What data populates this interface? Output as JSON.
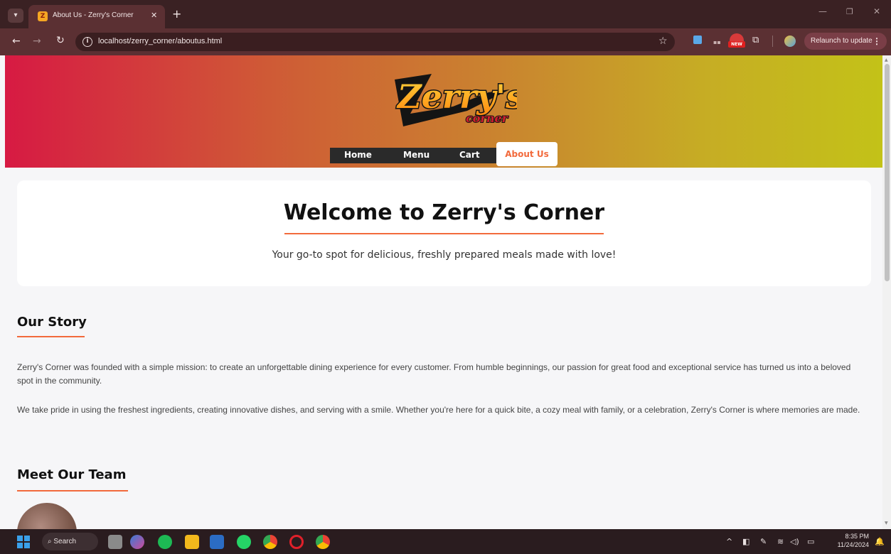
{
  "browser": {
    "tab_title": "About Us - Zerry's Corner",
    "url": "localhost/zerry_corner/aboutus.html",
    "relaunch_label": "Relaunch to update",
    "new_badge": "NEW"
  },
  "nav": {
    "items": [
      {
        "label": "Home"
      },
      {
        "label": "Menu"
      },
      {
        "label": "Cart"
      },
      {
        "label": "About Us",
        "active": true
      }
    ]
  },
  "logo": {
    "main": "Zerry's",
    "sub": "corner"
  },
  "welcome": {
    "title": "Welcome to Zerry's Corner",
    "subtitle": "Your go-to spot for delicious, freshly prepared meals made with love!"
  },
  "story": {
    "title": "Our Story",
    "paragraphs": [
      "Zerry's Corner was founded with a simple mission: to create an unforgettable dining experience for every customer. From humble beginnings, our passion for great food and exceptional service has turned us into a beloved spot in the community.",
      "We take pride in using the freshest ingredients, creating innovative dishes, and serving with a smile. Whether you're here for a quick bite, a cozy meal with family, or a celebration, Zerry's Corner is where memories are made."
    ]
  },
  "team": {
    "title": "Meet Our Team"
  },
  "taskbar": {
    "search_label": "Search",
    "time": "8:35 PM",
    "date": "11/24/2024"
  },
  "colors": {
    "accent": "#f26a3c",
    "hero_start": "#d71a43",
    "hero_end": "#c3c218",
    "nav_bg": "#2a2a2a"
  }
}
